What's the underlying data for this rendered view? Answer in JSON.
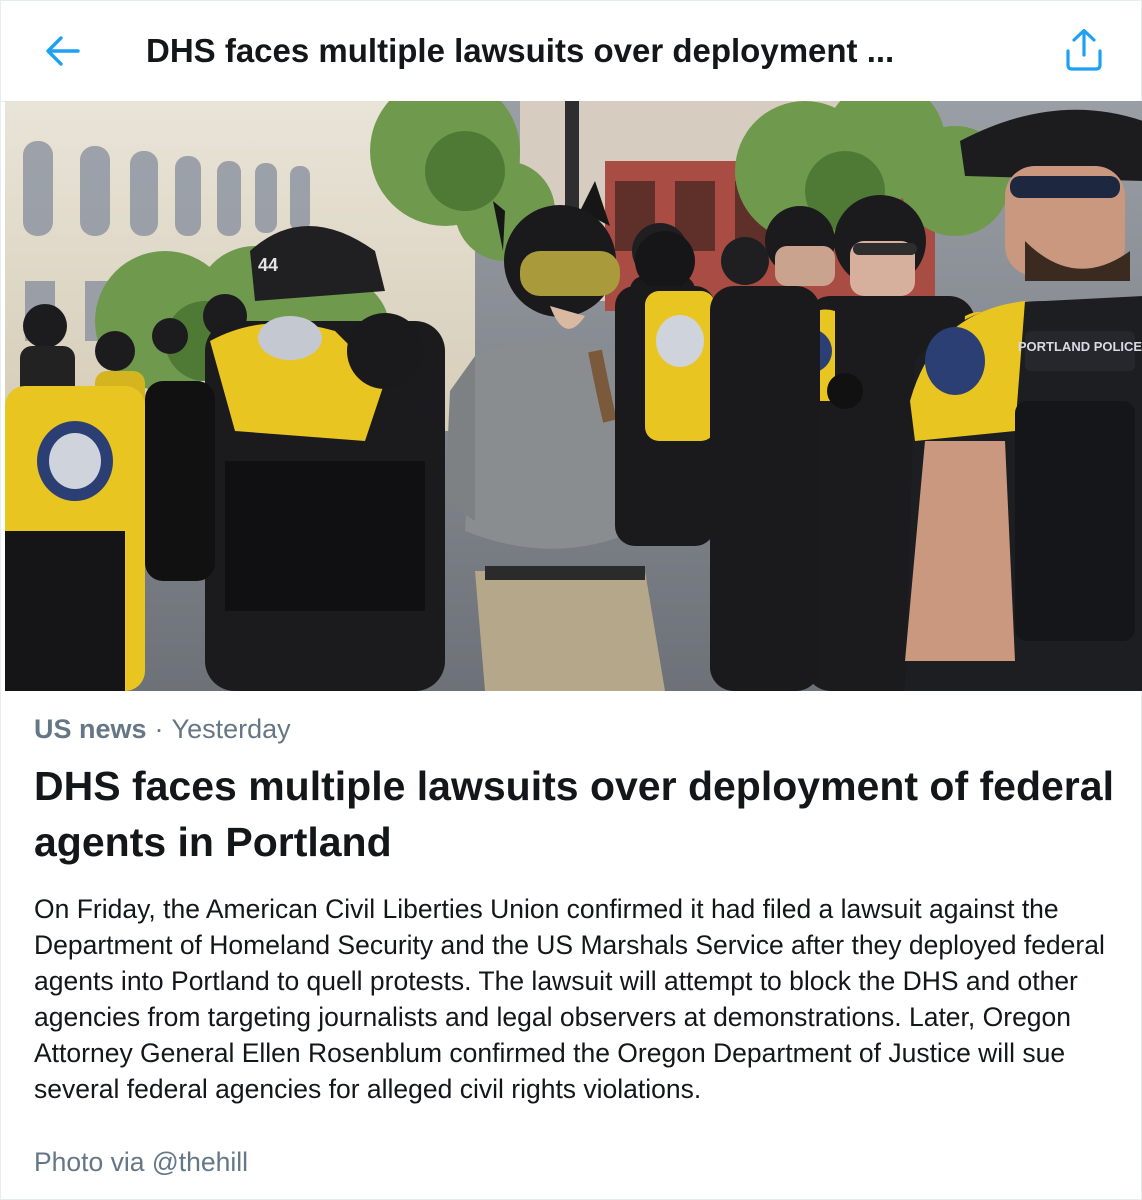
{
  "header": {
    "title": "DHS faces multiple lawsuits over deployment ...",
    "back_icon": "arrow-left-icon",
    "share_icon": "share-icon",
    "accent_color": "#1da1f2"
  },
  "photo": {
    "patch_text": "PORTLAND POLICE",
    "helmet_number": "44"
  },
  "article": {
    "source": "US news",
    "separator": "·",
    "time": "Yesterday",
    "headline": "DHS faces multiple lawsuits over deployment of federal agents in Portland",
    "summary": "On Friday, the American Civil Liberties Union confirmed it had filed a lawsuit against the Department of Homeland Security and the US Marshals Service after they deployed federal agents into Portland to quell protests. The lawsuit will attempt to block the DHS and other agencies from targeting journalists and legal observers at demonstrations. Later, Oregon Attorney General Ellen Rosenblum confirmed the Oregon Department of Justice will sue several federal agencies for alleged civil rights violations.",
    "credit": "Photo via @thehill"
  }
}
